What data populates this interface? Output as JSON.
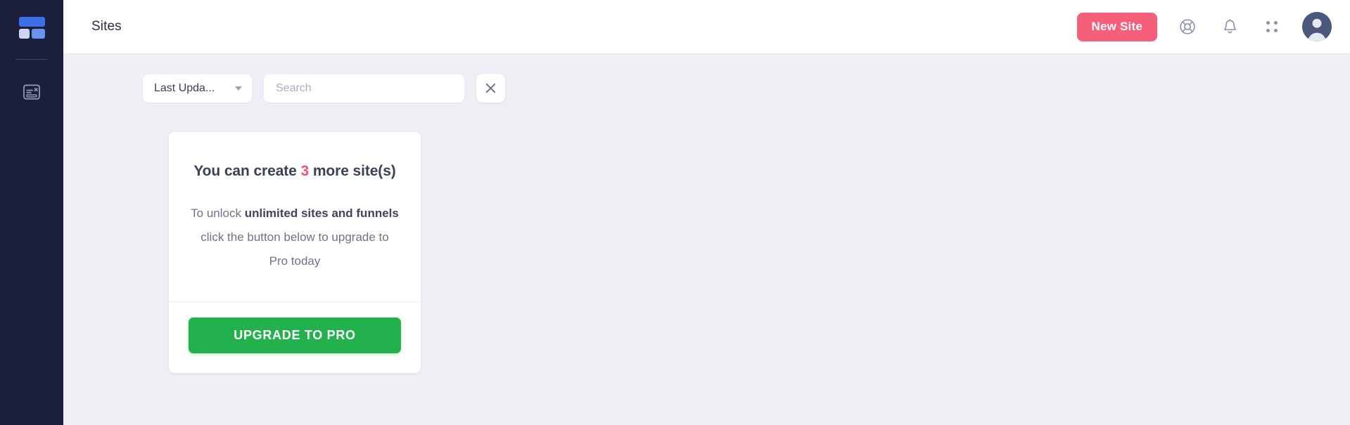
{
  "sidebar": {
    "logo": {
      "icon": "dashboard-grid-logo",
      "colors": {
        "top": "#3d6fe8",
        "bottom_left": "#ccd7f3",
        "bottom_right": "#6a93f0"
      }
    },
    "items": [
      {
        "id": "pages",
        "icon": "article-document-icon",
        "label": ""
      }
    ]
  },
  "header": {
    "title": "Sites",
    "new_site_label": "New Site",
    "new_site_color": "#f65f79",
    "icons": [
      {
        "name": "lifebuoy-support-icon"
      },
      {
        "name": "bell-notification-icon"
      },
      {
        "name": "apps-dots-grid-icon"
      },
      {
        "name": "user-avatar"
      }
    ]
  },
  "toolbar": {
    "sort": {
      "value": "Last Upda...",
      "icon": "chevron-down-icon"
    },
    "search": {
      "value": "",
      "placeholder": "Search"
    },
    "clear": {
      "icon": "close-x-icon",
      "label": ""
    }
  },
  "upgrade_card": {
    "heading_prefix": "You can create ",
    "heading_count": "3",
    "heading_suffix": " more site(s)",
    "body_1": "To unlock ",
    "body_bold": "unlimited sites and funnels",
    "body_2": " click the button below to upgrade to Pro today",
    "button_label": "UPGRADE TO PRO",
    "button_color": "#22b14c",
    "count_color": "#f4506f"
  }
}
